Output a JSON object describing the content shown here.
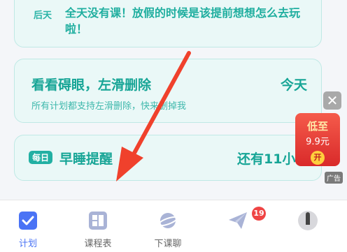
{
  "cards": {
    "top": {
      "day": "后天",
      "text": "全天没有课！放假的时候是该提前想想怎么去玩啦！"
    },
    "middle": {
      "title": "看看碍眼，左滑删除",
      "day": "今天",
      "subtitle": "所有计划都支持左滑删除，快来删掉我"
    },
    "bottom": {
      "badge": "每日",
      "title": "早睡提醒",
      "right": "还有11小"
    }
  },
  "ad": {
    "line1": "低至",
    "line2": "9.9元",
    "coin": "开",
    "tag": "广告",
    "close": "✕"
  },
  "tabs": [
    {
      "label": "计划",
      "icon": "checkbox-icon"
    },
    {
      "label": "课程表",
      "icon": "grid-icon"
    },
    {
      "label": "下课聊",
      "icon": "planet-icon"
    },
    {
      "label": "",
      "icon": "paper-plane-icon"
    },
    {
      "label": "",
      "icon": "avatar"
    }
  ],
  "notification_count": "19",
  "colors": {
    "accent": "#4a73f5",
    "teal": "#17a596",
    "arrow": "#f0412c"
  }
}
